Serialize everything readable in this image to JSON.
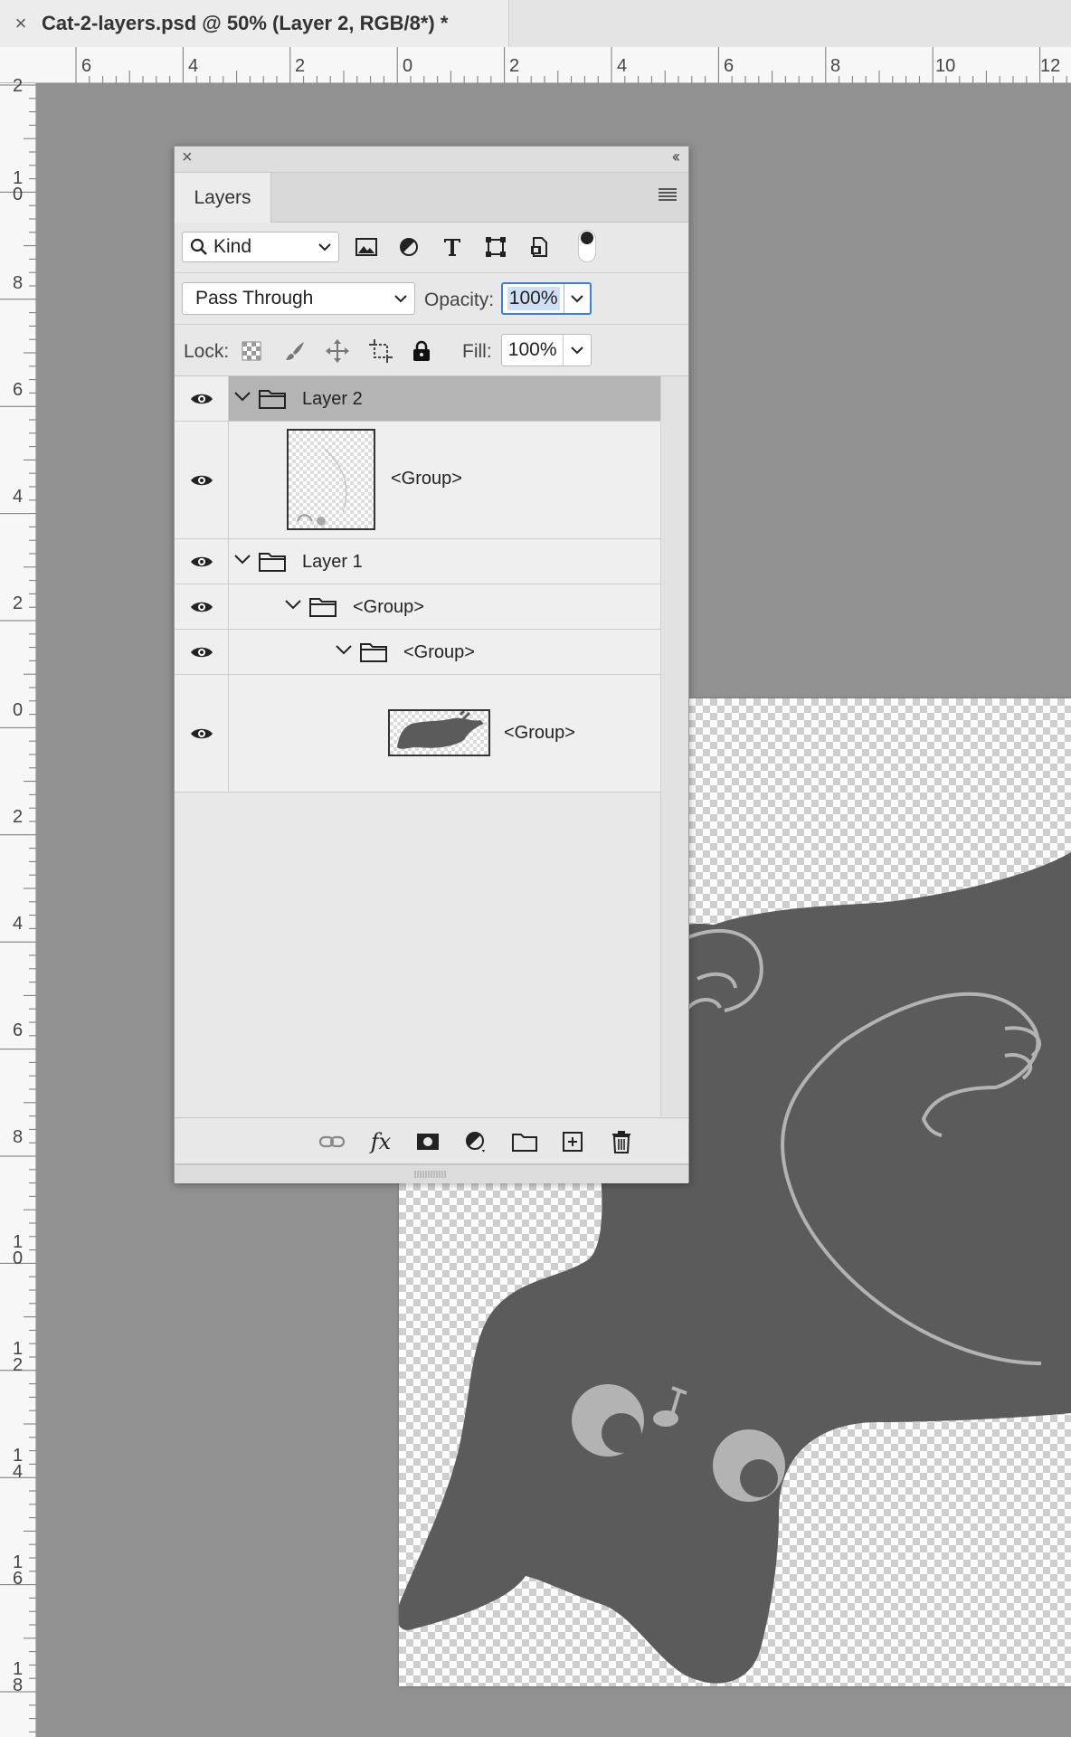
{
  "document_tab": {
    "close_symbol": "×",
    "title": "Cat-2-layers.psd @ 50% (Layer 2, RGB/8*) *"
  },
  "ruler_top_labels": [
    "6",
    "4",
    "2",
    "0",
    "2",
    "4",
    "6",
    "8",
    "10",
    "12"
  ],
  "ruler_left_labels": [
    "2",
    "10",
    "8",
    "6",
    "4",
    "2",
    "0",
    "2",
    "4",
    "6",
    "8",
    "10",
    "12",
    "14",
    "16",
    "18"
  ],
  "layers_panel": {
    "close_symbol": "×",
    "collapse_symbol": "‹‹",
    "tab_label": "Layers",
    "filter": {
      "kind_label": "Kind",
      "filter_icons": [
        "image-filter-icon",
        "adjustment-filter-icon",
        "type-filter-icon",
        "shape-filter-icon",
        "smart-object-filter-icon"
      ],
      "toggle_on": true
    },
    "blend_mode": "Pass Through",
    "opacity_label": "Opacity:",
    "opacity_value": "100%",
    "lock_label": "Lock:",
    "lock_icons": [
      "lock-transparent-icon",
      "lock-image-icon",
      "lock-position-icon",
      "lock-artboard-icon",
      "lock-all-icon"
    ],
    "fill_label": "Fill:",
    "fill_value": "100%",
    "layers": [
      {
        "name": "Layer 2",
        "type": "group",
        "expanded": true,
        "indent": 0,
        "selected": true,
        "visible": true
      },
      {
        "name": "<Group>",
        "type": "layer-thumb",
        "indent": 1,
        "visible": true
      },
      {
        "name": "Layer 1",
        "type": "group",
        "expanded": true,
        "indent": 0,
        "visible": true
      },
      {
        "name": "<Group>",
        "type": "group",
        "expanded": true,
        "indent": 1,
        "visible": true
      },
      {
        "name": "<Group>",
        "type": "group",
        "expanded": true,
        "indent": 2,
        "visible": true
      },
      {
        "name": "<Group>",
        "type": "layer-thumb",
        "indent": 3,
        "visible": true
      }
    ],
    "footer_icons": [
      "link-layers-icon",
      "fx-icon",
      "mask-icon",
      "adjustment-layer-icon",
      "new-group-icon",
      "new-layer-icon",
      "delete-icon"
    ],
    "fx_text": "fx"
  },
  "colors": {
    "workspace": "#919191",
    "cat_body": "#5b5b5c",
    "cat_line": "#b3b3b3",
    "selection_accent": "#3b7dd8"
  }
}
